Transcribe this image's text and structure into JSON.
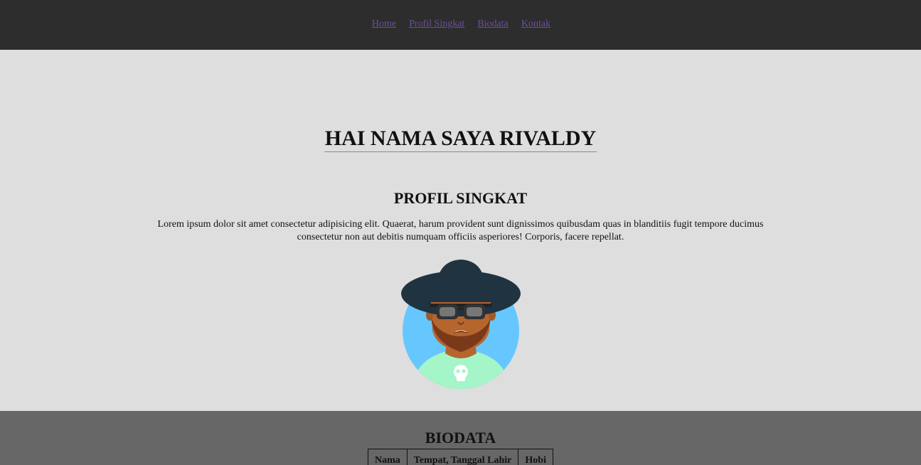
{
  "nav": {
    "items": [
      {
        "label": "Home"
      },
      {
        "label": "Profil Singkat"
      },
      {
        "label": "Biodata"
      },
      {
        "label": "Kontak"
      }
    ],
    "link_color": "#6b4fa0"
  },
  "hero": {
    "title": "HAI NAMA SAYA RIVALDY",
    "section_title": "PROFIL SINGKAT",
    "paragraph": "Lorem ipsum dolor sit amet consectetur adipisicing elit. Quaerat, harum provident sunt dignissimos quibusdam quas in blanditiis fugit tempore ducimus consectetur non aut debitis numquam officiis asperiores! Corporis, facere repellat.",
    "avatar_icon": "hipster-avatar-icon"
  },
  "biodata": {
    "title": "BIODATA",
    "columns": [
      "Nama",
      "Tempat, Tanggal Lahir",
      "Hobi"
    ]
  },
  "colors": {
    "topbar": "#2d2d2d",
    "hero_bg": "#dedede",
    "bio_bg": "#676767"
  }
}
